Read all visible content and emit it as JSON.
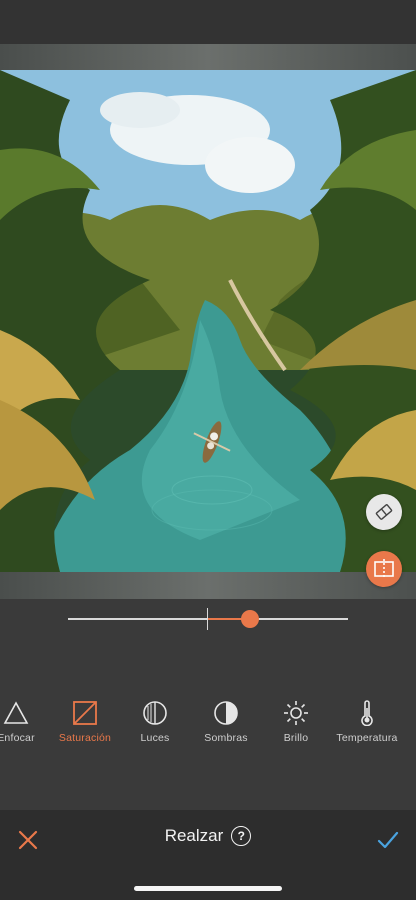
{
  "editor": {
    "photo_subject": "tropical-river-with-palms-and-boat",
    "slider": {
      "value": 0.65,
      "min": 0,
      "max": 1,
      "center": 0.5
    },
    "colors": {
      "accent": "#e9784a",
      "background": "#3a3a3a",
      "bar": "#2d2d2d"
    }
  },
  "tools": [
    {
      "id": "enfocar",
      "label": "Enfocar",
      "icon": "triangle-icon"
    },
    {
      "id": "saturacion",
      "label": "Saturación",
      "icon": "saturation-icon",
      "active": true
    },
    {
      "id": "luces",
      "label": "Luces",
      "icon": "highlights-icon"
    },
    {
      "id": "sombras",
      "label": "Sombras",
      "icon": "shadows-icon"
    },
    {
      "id": "brillo",
      "label": "Brillo",
      "icon": "sun-icon"
    },
    {
      "id": "temperatura",
      "label": "Temperatura",
      "icon": "thermometer-icon"
    }
  ],
  "bottom": {
    "title": "Realzar",
    "help": "?"
  }
}
